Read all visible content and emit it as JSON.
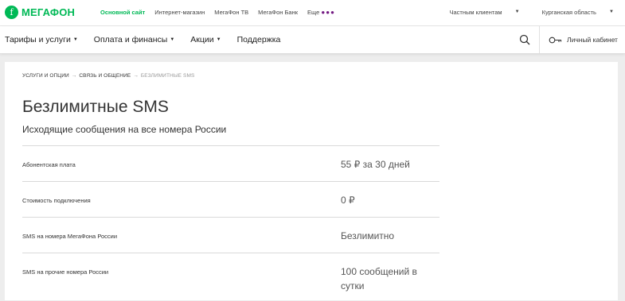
{
  "logo": {
    "text": "МЕГАФОН"
  },
  "topnav": [
    {
      "label": "Основной сайт"
    },
    {
      "label": "Интернет-магазин"
    },
    {
      "label": "МегаФон ТВ"
    },
    {
      "label": "МегаФон Банк"
    },
    {
      "label": "Еще"
    }
  ],
  "topright": {
    "segment": "Частным клиентам",
    "region": "Курганская область"
  },
  "menu": [
    {
      "label": "Тарифы и услуги"
    },
    {
      "label": "Оплата и финансы"
    },
    {
      "label": "Акции"
    },
    {
      "label": "Поддержка"
    }
  ],
  "cabinet": {
    "label": "Личный кабинет"
  },
  "breadcrumb": {
    "item1": "Услуги и опции",
    "item2": "Связь и общение",
    "current": "Безлимитные SMS",
    "separator": "→"
  },
  "page": {
    "title": "Безлимитные SMS",
    "subtitle": "Исходящие сообщения на все номера России"
  },
  "rows": [
    {
      "label": "Абонентская плата",
      "value": "55 ₽ за 30 дней"
    },
    {
      "label": "Стоимость подключения",
      "value": "0 ₽"
    },
    {
      "label": "SMS на номера МегаФона России",
      "value": "Безлимитно"
    },
    {
      "label": "SMS на прочие номера России",
      "value": "100 сообщений в сутки"
    }
  ],
  "colors": {
    "brand": "#00b956",
    "accent": "#731982"
  }
}
